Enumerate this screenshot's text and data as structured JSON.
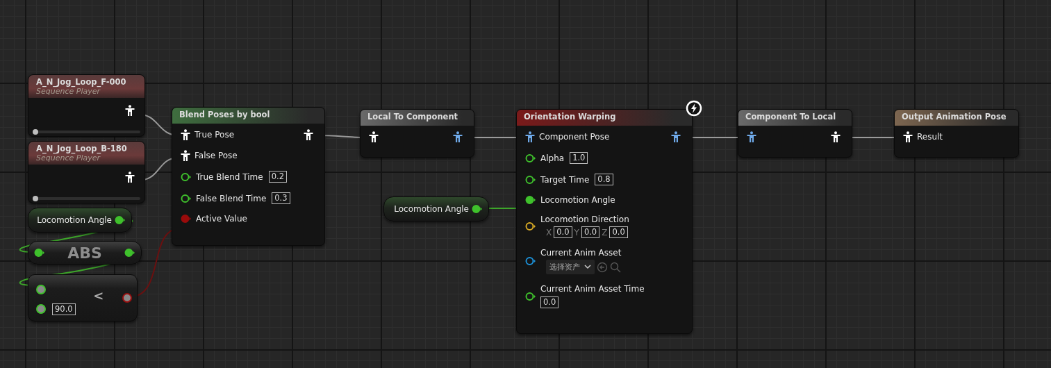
{
  "nodes": [
    {
      "kind": "sequence",
      "title": "A_N_Jog_Loop_F-000",
      "subtitle": "Sequence Player",
      "level": 0
    },
    {
      "kind": "sequence",
      "title": "A_N_Jog_Loop_B-180",
      "subtitle": "Sequence Player",
      "level": 0
    },
    {
      "kind": "variable",
      "title": "Locomotion Angle",
      "pin_connected": true
    },
    {
      "kind": "operator",
      "title": "ABS"
    },
    {
      "kind": "compare",
      "title": "<",
      "value": "90.0"
    },
    {
      "kind": "function",
      "title": "Blend Poses by bool",
      "color": "#3f6e3f",
      "rows": [
        {
          "input": {
            "kind": "pose",
            "label": "True Pose"
          },
          "output": {
            "kind": "pose"
          }
        },
        {
          "input": {
            "kind": "pose",
            "label": "False Pose"
          }
        },
        {
          "input": {
            "kind": "float",
            "label": "True Blend Time",
            "value": "0.2",
            "connected": false
          }
        },
        {
          "input": {
            "kind": "float",
            "label": "False Blend Time",
            "value": "0.3",
            "connected": false
          }
        },
        {
          "input": {
            "kind": "bool",
            "label": "Active Value",
            "connected": true
          }
        }
      ]
    },
    {
      "kind": "function",
      "title": "Local To Component",
      "color": "#6a6a6a",
      "rows": [
        {
          "input": {
            "kind": "pose"
          },
          "output": {
            "kind": "component_pose"
          }
        }
      ]
    },
    {
      "kind": "variable",
      "title": "Locomotion Angle",
      "pin_connected": true
    },
    {
      "kind": "function",
      "title": "Orientation Warping",
      "color": "#7a1a1a",
      "badge": true,
      "rows": [
        {
          "input": {
            "kind": "component_pose",
            "label": "Component Pose"
          },
          "output": {
            "kind": "component_pose"
          }
        },
        {
          "input": {
            "kind": "float",
            "label": "Alpha",
            "value": "1.0",
            "connected": false
          }
        },
        {
          "input": {
            "kind": "float",
            "label": "Target Time",
            "value": "0.8",
            "connected": false
          }
        },
        {
          "input": {
            "kind": "float",
            "label": "Locomotion Angle",
            "connected": true
          }
        },
        {
          "input": {
            "kind": "vector",
            "label": "Locomotion Direction",
            "connected": false,
            "components": [
              {
                "axis": "X",
                "value": "0.0"
              },
              {
                "axis": "Y",
                "value": "0.0"
              },
              {
                "axis": "Z",
                "value": "0.0"
              }
            ]
          }
        },
        {
          "input": {
            "kind": "asset",
            "label": "Current Anim Asset",
            "value": "选择资产",
            "connected": false
          }
        },
        {
          "input": {
            "kind": "float",
            "label": "Current Anim Asset Time",
            "value": "0.0",
            "connected": false
          }
        }
      ]
    },
    {
      "kind": "function",
      "title": "Component To Local",
      "color": "#6a6a6a",
      "rows": [
        {
          "input": {
            "kind": "component_pose"
          },
          "output": {
            "kind": "pose"
          }
        }
      ]
    },
    {
      "kind": "function",
      "title": "Output Animation Pose",
      "color": "#7d6650",
      "rows": [
        {
          "input": {
            "kind": "pose",
            "label": "Result"
          }
        }
      ]
    }
  ]
}
